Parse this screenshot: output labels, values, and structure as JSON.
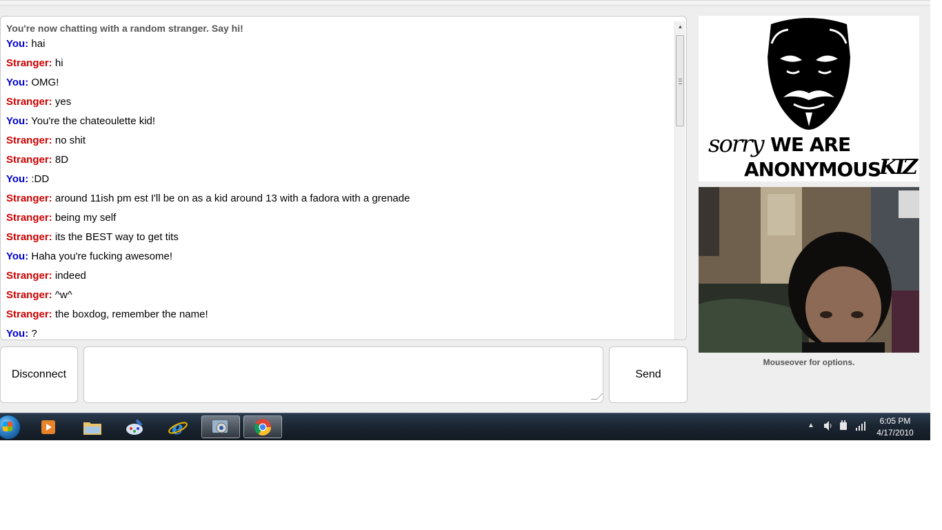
{
  "chat": {
    "status": "You're now chatting with a random stranger. Say hi!",
    "messages": [
      {
        "sender": "You:",
        "role": "you",
        "text": "hai"
      },
      {
        "sender": "Stranger:",
        "role": "stranger",
        "text": "hi"
      },
      {
        "sender": "You:",
        "role": "you",
        "text": "OMG!"
      },
      {
        "sender": "Stranger:",
        "role": "stranger",
        "text": "yes"
      },
      {
        "sender": "You:",
        "role": "you",
        "text": "You're the chateoulette kid!"
      },
      {
        "sender": "Stranger:",
        "role": "stranger",
        "text": "no shit"
      },
      {
        "sender": "Stranger:",
        "role": "stranger",
        "text": "8D"
      },
      {
        "sender": "You:",
        "role": "you",
        "text": ":DD"
      },
      {
        "sender": "Stranger:",
        "role": "stranger",
        "text": "around 11ish pm est I'll be on as a kid around 13 with a fadora with a grenade"
      },
      {
        "sender": "Stranger:",
        "role": "stranger",
        "text": "being my self"
      },
      {
        "sender": "Stranger:",
        "role": "stranger",
        "text": "its the BEST way to get tits"
      },
      {
        "sender": "You:",
        "role": "you",
        "text": "Haha you're fucking awesome!"
      },
      {
        "sender": "Stranger:",
        "role": "stranger",
        "text": "indeed"
      },
      {
        "sender": "Stranger:",
        "role": "stranger",
        "text": "^w^"
      },
      {
        "sender": "Stranger:",
        "role": "stranger",
        "text": "the boxdog, remember the name!"
      },
      {
        "sender": "You:",
        "role": "you",
        "text": "?"
      }
    ],
    "colors": {
      "you": "#0000cc",
      "stranger": "#cc0000"
    }
  },
  "controls": {
    "disconnect_label": "Disconnect",
    "send_label": "Send",
    "message_value": ""
  },
  "video": {
    "stranger_caption_line1": "WE ARE",
    "stranger_caption_handwritten": "sorry",
    "stranger_caption_line2": "ANONYMOUS",
    "stranger_caption_handwritten2": "KIZ",
    "mouseover_text": "Mouseover for options."
  },
  "taskbar": {
    "apps": [
      "start-orb",
      "media-player-icon",
      "explorer-icon",
      "paint-icon",
      "ie-icon",
      "app-icon",
      "chrome-icon"
    ],
    "clock_time": "6:05 PM",
    "clock_date": "4/17/2010"
  }
}
